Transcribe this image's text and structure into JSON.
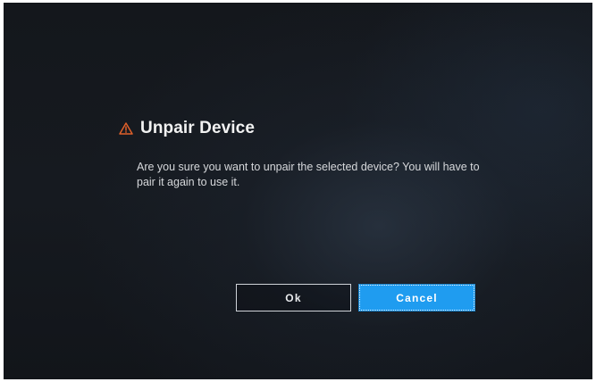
{
  "dialog": {
    "title": "Unpair Device",
    "icon": "warning-icon",
    "message": "Are you sure you want to unpair the selected device? You will have to pair it again to use it.",
    "buttons": {
      "ok_label": "Ok",
      "cancel_label": "Cancel"
    }
  },
  "colors": {
    "background": "#14171c",
    "warning_icon": "#e0602a",
    "title_text": "#f2f2f2",
    "message_text": "#d6d8db",
    "cancel_button": "#1f9cf0",
    "ok_border": "#cfd3d8"
  }
}
